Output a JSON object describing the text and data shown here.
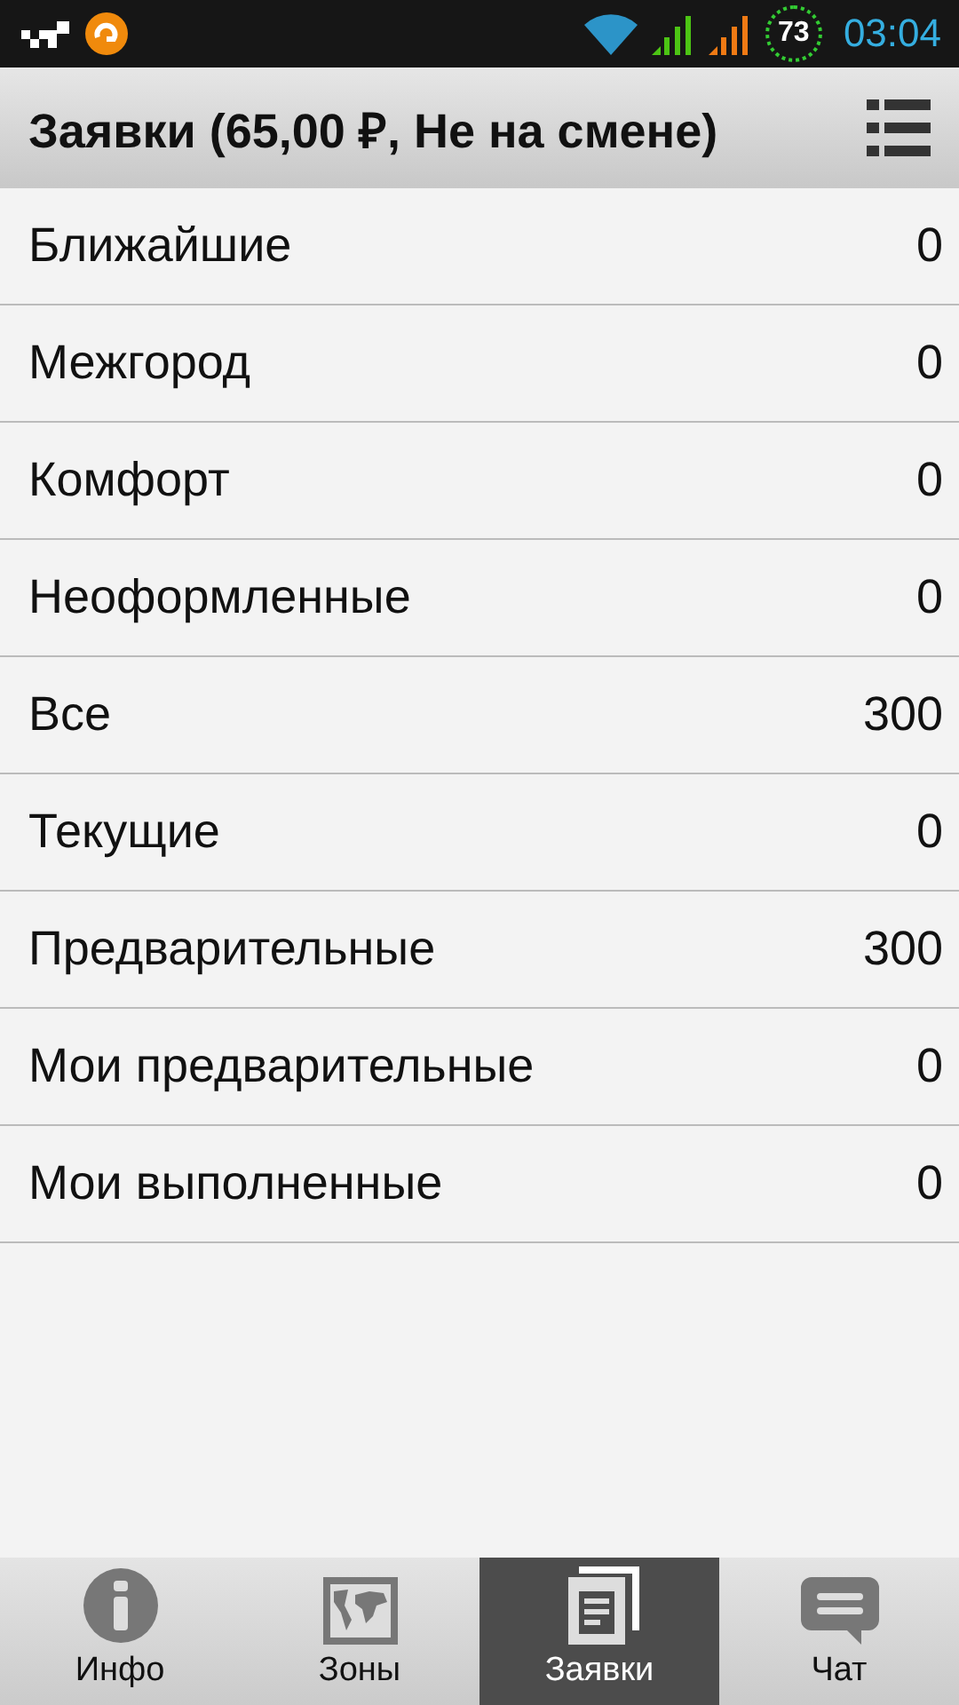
{
  "status_bar": {
    "battery": "73",
    "time": "03:04"
  },
  "header": {
    "title": "Заявки (65,00 ₽, Не на смене)"
  },
  "rows": [
    {
      "label": "Ближайшие",
      "count": "0"
    },
    {
      "label": "Межгород",
      "count": "0"
    },
    {
      "label": "Комфорт",
      "count": "0"
    },
    {
      "label": "Неоформленные",
      "count": "0"
    },
    {
      "label": "Все",
      "count": "300"
    },
    {
      "label": "Текущие",
      "count": "0"
    },
    {
      "label": "Предварительные",
      "count": "300"
    },
    {
      "label": "Мои предварительные",
      "count": "0"
    },
    {
      "label": "Мои выполненные",
      "count": "0"
    }
  ],
  "tabs": [
    {
      "kind": "info",
      "label": "Инфо",
      "selected": false
    },
    {
      "kind": "zones",
      "label": "Зоны",
      "selected": false
    },
    {
      "kind": "orders",
      "label": "Заявки",
      "selected": true
    },
    {
      "kind": "chat",
      "label": "Чат",
      "selected": false
    }
  ]
}
